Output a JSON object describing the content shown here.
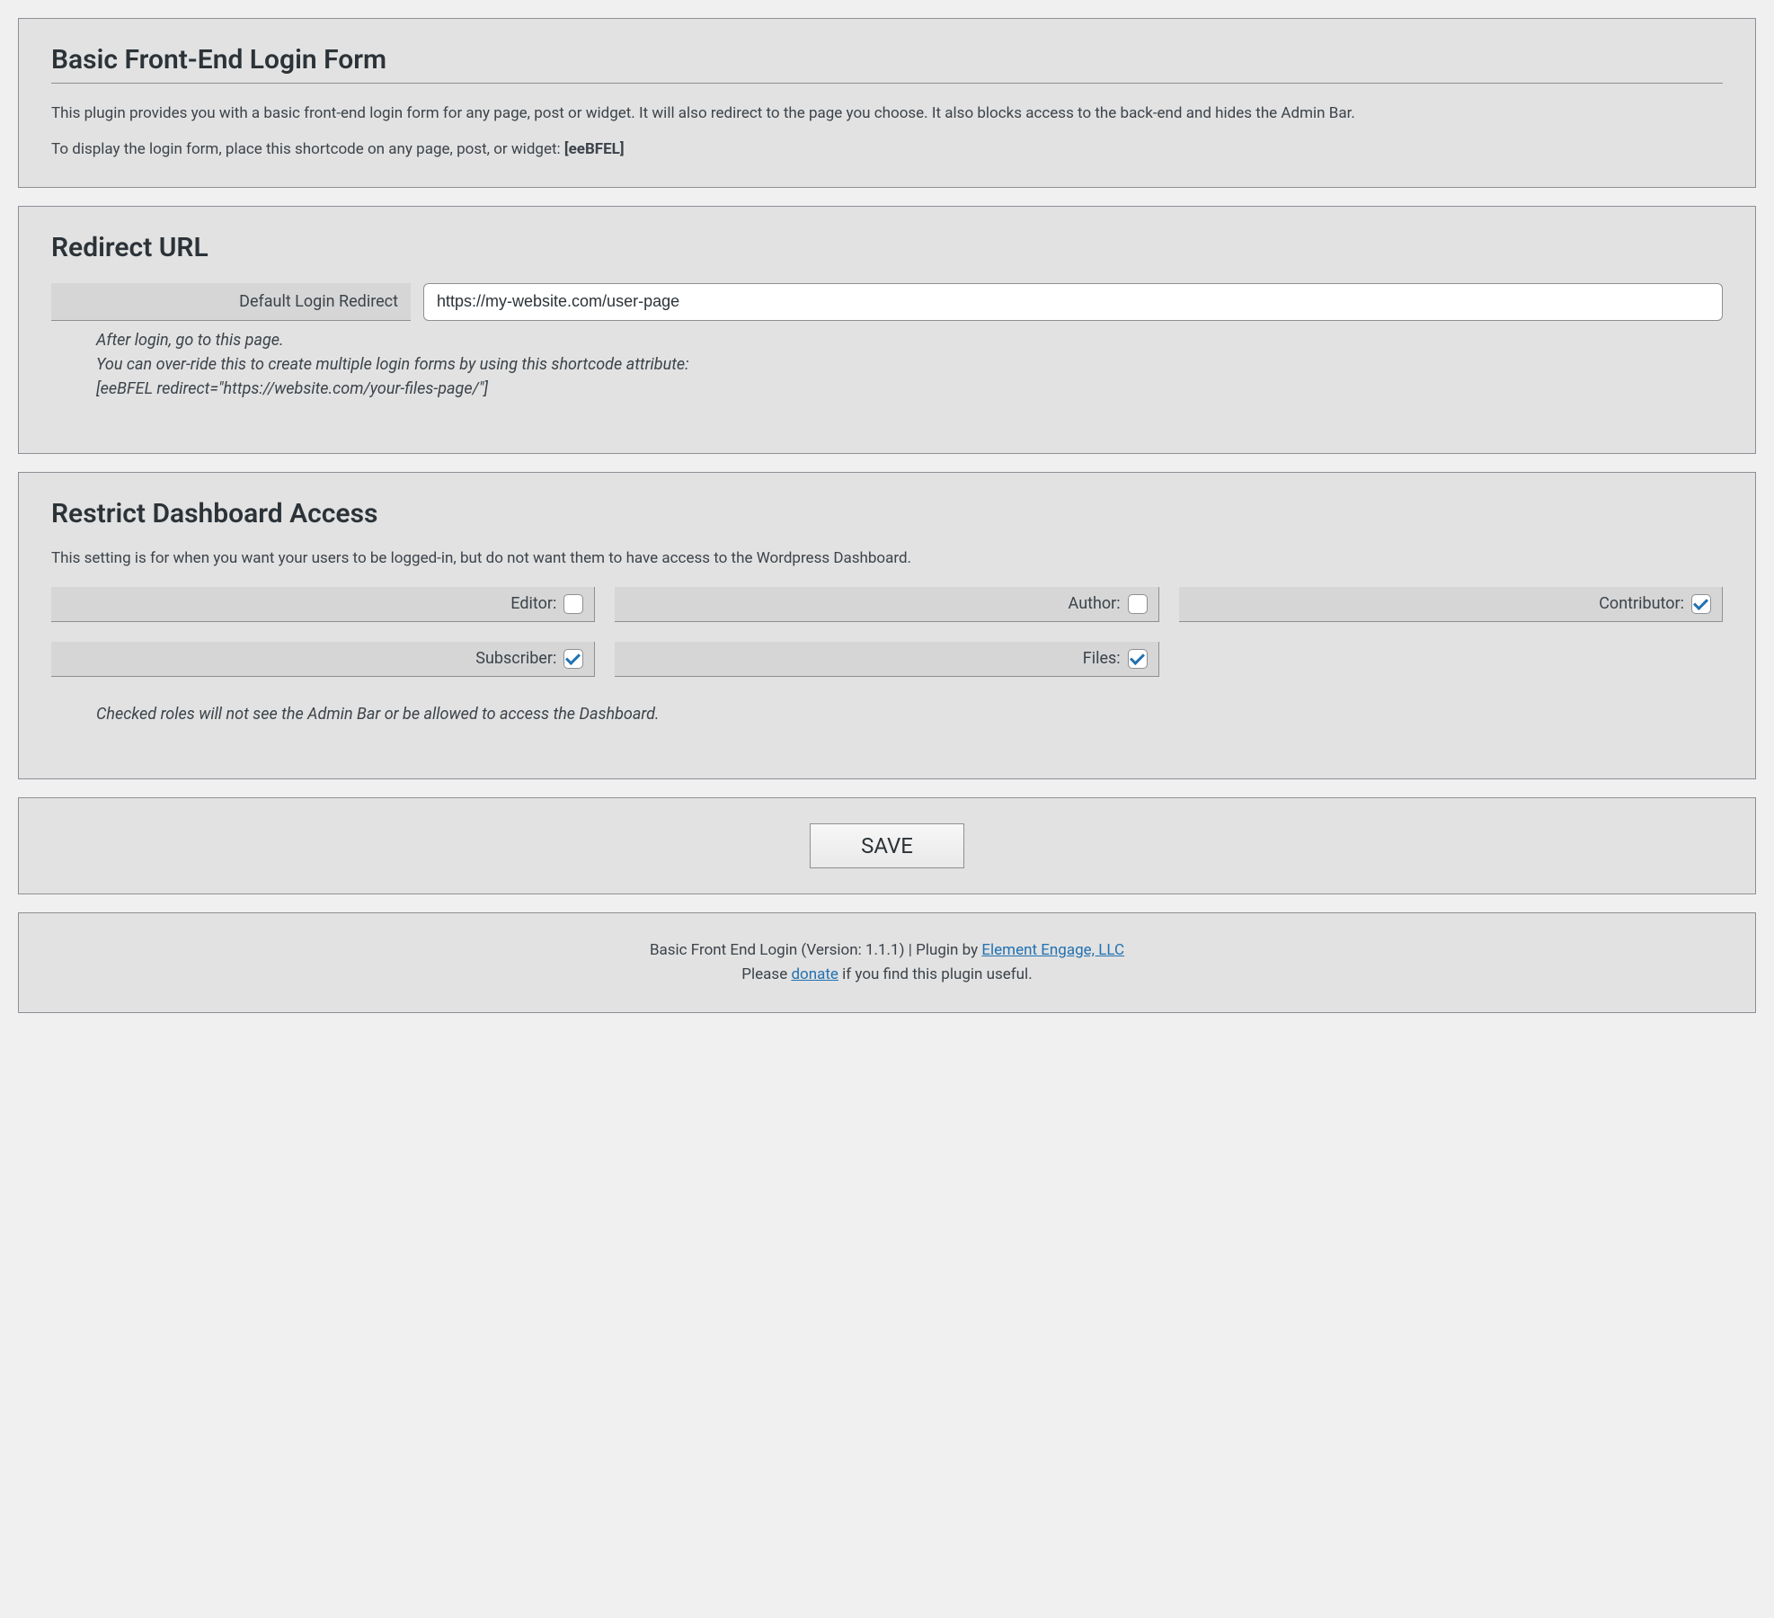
{
  "intro": {
    "title": "Basic Front-End Login Form",
    "desc1": "This plugin provides you with a basic front-end login form for any page, post or widget. It will also redirect to the page you choose. It also blocks access to the back-end and hides the Admin Bar.",
    "desc2_prefix": "To display the login form, place this shortcode on any page, post, or widget: ",
    "shortcode": "[eeBFEL]"
  },
  "redirect": {
    "title": "Redirect URL",
    "label": "Default Login Redirect",
    "value": "https://my-website.com/user-page",
    "help_line1": "After login, go to this page.",
    "help_line2": "You can over-ride this to create multiple login forms by using this shortcode attribute:",
    "help_line3": "[eeBFEL redirect=\"https://website.com/your-files-page/\"]"
  },
  "restrict": {
    "title": "Restrict Dashboard Access",
    "desc": "This setting is for when you want your users to be logged-in, but do not want them to have access to the Wordpress Dashboard.",
    "roles": [
      {
        "label": "Editor:",
        "checked": false
      },
      {
        "label": "Author:",
        "checked": false
      },
      {
        "label": "Contributor:",
        "checked": true
      },
      {
        "label": "Subscriber:",
        "checked": true
      },
      {
        "label": "Files:",
        "checked": true
      }
    ],
    "help": "Checked roles will not see the Admin Bar or be allowed to access the Dashboard."
  },
  "save": {
    "label": "SAVE"
  },
  "footer": {
    "line1_prefix": "Basic Front End Login (Version: 1.1.1) | Plugin by ",
    "link1": "Element Engage, LLC",
    "line2_prefix": "Please ",
    "link2": "donate",
    "line2_suffix": " if you find this plugin useful."
  }
}
